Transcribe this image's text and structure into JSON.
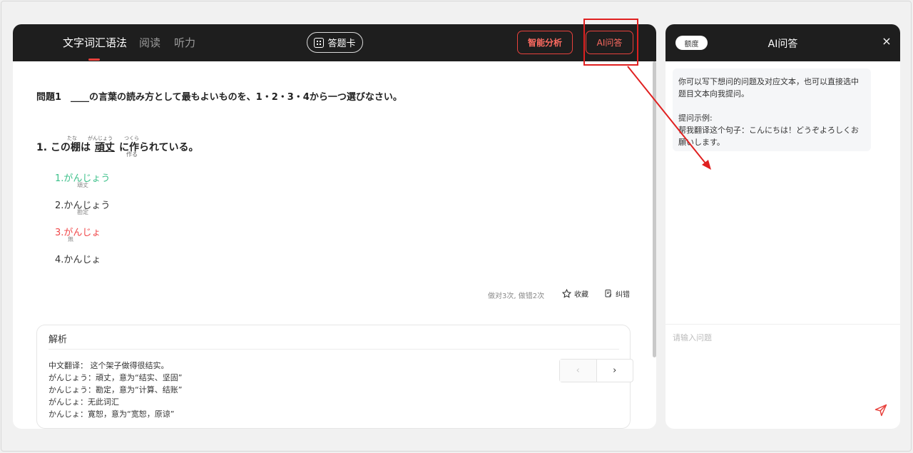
{
  "tabs": [
    {
      "label": "文字词汇语法",
      "active": true
    },
    {
      "label": "阅读",
      "active": false
    },
    {
      "label": "听力",
      "active": false
    }
  ],
  "answer_card_label": "答题卡",
  "analysis_button_label": "智能分析",
  "ai_button_label": "AI问答",
  "question": {
    "title": "問題1　____の言葉の読み方として最もよいものを、1・2・3・4から一つ選びなさい。",
    "sentence_prefix": "1. この",
    "sentence_kanji1": "棚",
    "sentence_mid1": "は",
    "sentence_target": "頑丈",
    "sentence_mid2": "に",
    "sentence_kanji2": "作",
    "sentence_suffix": "られている。",
    "ruby_tana": "たな",
    "ruby_ganjou": "がんじょう",
    "ruby_tsukura": "つくら",
    "ruby_tsukuru": "作る"
  },
  "options": [
    {
      "label": "1.がんじょう",
      "sub": "頑丈",
      "state": "correct"
    },
    {
      "label": "2.かんじょう",
      "sub": "勘定",
      "state": "normal"
    },
    {
      "label": "3.がんじょ",
      "sub": "無",
      "state": "wrong"
    },
    {
      "label": "4.かんじょ",
      "sub": "",
      "state": "normal"
    }
  ],
  "stats": "做对3次, 做错2次",
  "favorite_label": "收藏",
  "report_label": "纠错",
  "analysis": {
    "title": "解析",
    "lines": [
      "中文翻译： 这个架子做得很结实。",
      "がんじょう：頑丈，意为“结实、坚固”",
      "かんじょう：勘定，意为“计算、结账”",
      "がんじょ：无此词汇",
      "かんじょ：寛恕，意为“宽恕，原谅”"
    ]
  },
  "pager": {
    "prev": "‹",
    "next": "›"
  },
  "ai_panel": {
    "quota_label": "额度",
    "title": "AI问答",
    "close": "×",
    "hint_lines": [
      "你可以写下想问的问题及对应文本，也可以直接选中",
      "题目文本向我提问。",
      "",
      "提问示例:",
      "帮我翻译这个句子：こんにちは！どうぞよろしくお",
      "願いします。"
    ],
    "input_placeholder": "请输入问题"
  },
  "colors": {
    "accent": "#e8413c",
    "correct": "#3cc08a",
    "wrong": "#f0484a",
    "dark": "#1e1e1e"
  }
}
